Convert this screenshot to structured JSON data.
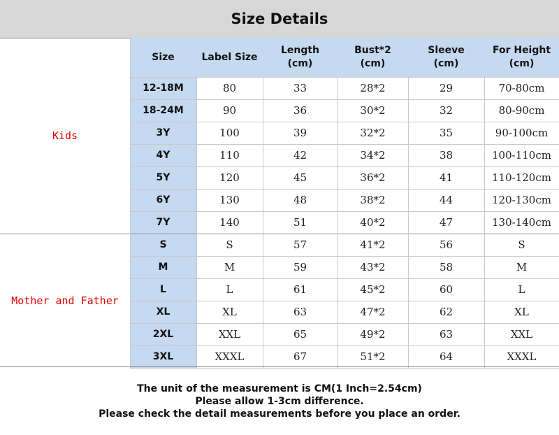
{
  "title": "Size Details",
  "columns": [
    "Size",
    "Label Size",
    "Length\n(cm)",
    "Bust*2\n(cm)",
    "Sleeve\n(cm)",
    "For Height\n(cm)"
  ],
  "groups": [
    {
      "label": "Kids",
      "rows": [
        [
          "12-18M",
          "80",
          "33",
          "28*2",
          "29",
          "70-80cm"
        ],
        [
          "18-24M",
          "90",
          "36",
          "30*2",
          "32",
          "80-90cm"
        ],
        [
          "3Y",
          "100",
          "39",
          "32*2",
          "35",
          "90-100cm"
        ],
        [
          "4Y",
          "110",
          "42",
          "34*2",
          "38",
          "100-110cm"
        ],
        [
          "5Y",
          "120",
          "45",
          "36*2",
          "41",
          "110-120cm"
        ],
        [
          "6Y",
          "130",
          "48",
          "38*2",
          "44",
          "120-130cm"
        ],
        [
          "7Y",
          "140",
          "51",
          "40*2",
          "47",
          "130-140cm"
        ]
      ]
    },
    {
      "label": "Mother and Father",
      "rows": [
        [
          "S",
          "S",
          "57",
          "41*2",
          "56",
          "S"
        ],
        [
          "M",
          "M",
          "59",
          "43*2",
          "58",
          "M"
        ],
        [
          "L",
          "L",
          "61",
          "45*2",
          "60",
          "L"
        ],
        [
          "XL",
          "XL",
          "63",
          "47*2",
          "62",
          "XL"
        ],
        [
          "2XL",
          "XXL",
          "65",
          "49*2",
          "63",
          "XXL"
        ],
        [
          "3XL",
          "XXXL",
          "67",
          "51*2",
          "64",
          "XXXL"
        ]
      ]
    }
  ],
  "footer": [
    "The unit of the measurement is CM(1 Inch=2.54cm)",
    "Please allow 1-3cm difference.",
    "Please check the detail measurements before you place an order."
  ]
}
